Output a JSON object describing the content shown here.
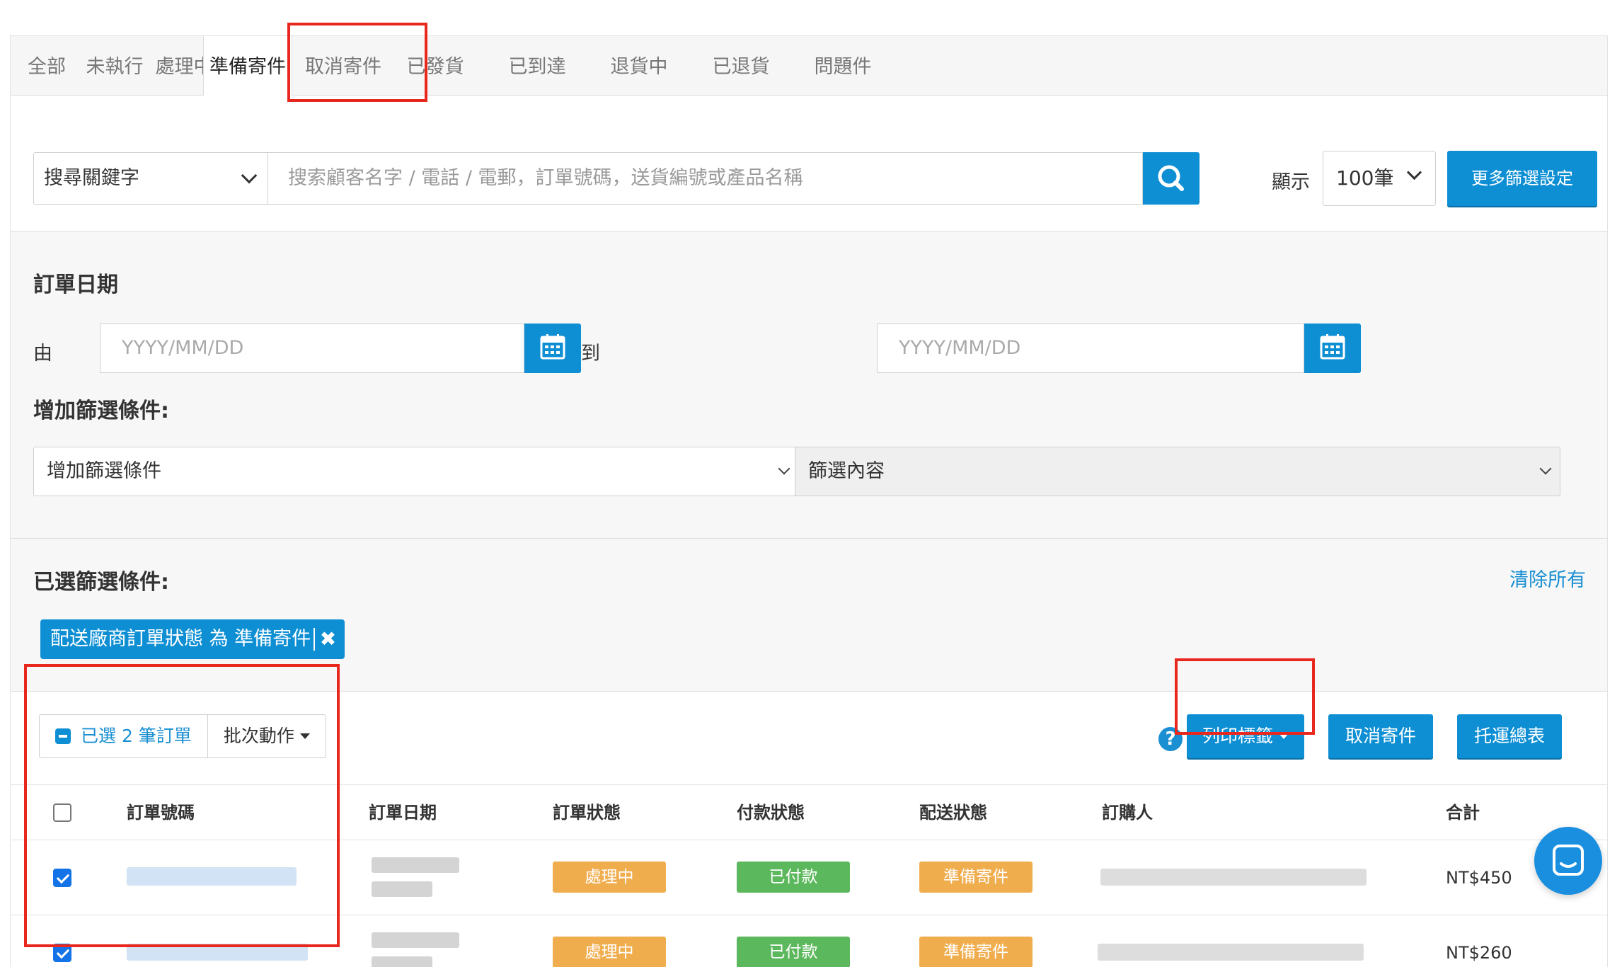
{
  "tabs": [
    {
      "label": "全部",
      "active": false
    },
    {
      "label": "未執行",
      "active": false
    },
    {
      "label": "處理中",
      "active": false
    },
    {
      "label": "準備寄件",
      "active": true
    },
    {
      "label": "取消寄件",
      "active": false
    },
    {
      "label": "已發貨",
      "active": false
    },
    {
      "label": "已到達",
      "active": false
    },
    {
      "label": "退貨中",
      "active": false
    },
    {
      "label": "已退貨",
      "active": false
    },
    {
      "label": "問題件",
      "active": false
    }
  ],
  "search": {
    "keyword_select": "搜尋關鍵字",
    "placeholder": "搜索顧客名字 / 電話 / 電郵，訂單號碼，送貨編號或產品名稱",
    "display_label": "顯示",
    "count_value": "100筆",
    "more_filters_label": "更多篩選設定"
  },
  "filters": {
    "order_date_title": "訂單日期",
    "from_label": "由",
    "to_label": "到",
    "date_placeholder": "YYYY/MM/DD",
    "add_condition_title": "增加篩選條件:",
    "add_condition_select": "增加篩選條件",
    "filter_content_select": "篩選內容"
  },
  "chosen": {
    "title": "已選篩選條件:",
    "clear_all": "清除所有",
    "chip_label": "配送廠商訂單狀態 為 準備寄件"
  },
  "actions": {
    "selected_label": "已選 2 筆訂單",
    "batch_label": "批次動作",
    "print_label": "列印標籤",
    "cancel_label": "取消寄件",
    "summary_label": "托運總表"
  },
  "table": {
    "headers": {
      "order_no": "訂單號碼",
      "order_date": "訂單日期",
      "order_status": "訂單狀態",
      "payment_status": "付款狀態",
      "delivery_status": "配送狀態",
      "buyer": "訂購人",
      "total": "合計"
    },
    "rows": [
      {
        "checked": true,
        "order_status": "處理中",
        "payment_status": "已付款",
        "delivery_status": "準備寄件",
        "total": "NT$450"
      },
      {
        "checked": true,
        "order_status": "處理中",
        "payment_status": "已付款",
        "delivery_status": "準備寄件",
        "total": "NT$260"
      }
    ]
  },
  "colors": {
    "accent": "#0e8fd4",
    "link": "#1a8fd2",
    "highlight": "#e8281e",
    "status_processing": "#f0ad4e",
    "status_paid": "#5cb85c",
    "status_preparing": "#f0ad4e"
  },
  "icons": {
    "search": "search-icon",
    "calendar": "calendar-icon",
    "help": "help-icon",
    "close": "close-icon",
    "chat": "chat-icon"
  }
}
